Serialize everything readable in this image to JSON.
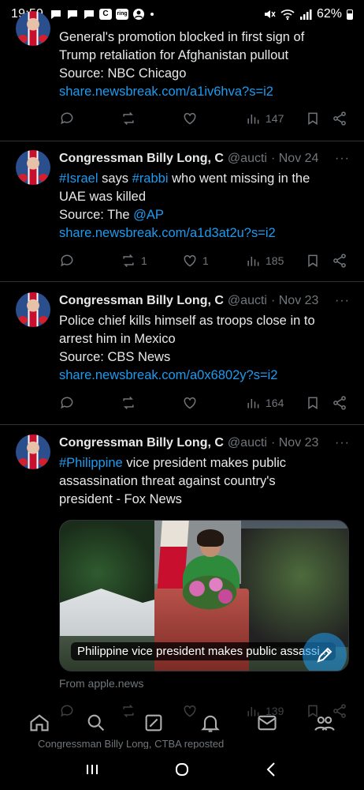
{
  "status_bar": {
    "time": "19:59",
    "notif_box_label": "C",
    "ring_label": "ring",
    "battery": "62%"
  },
  "tweets": [
    {
      "text_lines": [
        "General's promotion blocked in first sign of",
        "Trump retaliation for Afghanistan pullout",
        "Source: NBC Chicago"
      ],
      "link": "share.newsbreak.com/a1iv6hva?s=i2",
      "stats": {
        "replies": "",
        "reposts": "",
        "likes": "",
        "views": "147"
      }
    },
    {
      "author": "Congressman Billy Long, C",
      "handle": "@aucti",
      "date": "· Nov 24",
      "more": "···",
      "hashtag1": "#Israel",
      "word1": " says ",
      "hashtag2": "#rabbi",
      "rest1": " who went missing in the",
      "line2": "UAE was killed",
      "source_prefix": "Source: The ",
      "mention": "@AP",
      "link": "share.newsbreak.com/a1d3at2u?s=i2",
      "stats": {
        "replies": "",
        "reposts": "1",
        "likes": "1",
        "views": "185"
      }
    },
    {
      "author": "Congressman Billy Long, C",
      "handle": "@aucti",
      "date": "· Nov 23",
      "more": "···",
      "text_lines": [
        "Police chief kills himself as troops close in to",
        "arrest him in Mexico",
        "Source: CBS News"
      ],
      "link": "share.newsbreak.com/a0x6802y?s=i2",
      "stats": {
        "replies": "",
        "reposts": "",
        "likes": "",
        "views": "164"
      }
    },
    {
      "author": "Congressman Billy Long, C",
      "handle": "@aucti",
      "date": "· Nov 23",
      "more": "···",
      "hashtag1": "#Philippine",
      "rest1": " vice president makes public",
      "line2": "assassination threat against country's",
      "line3": "president - Fox News",
      "media_caption": "Philippine vice president makes public assassi...",
      "from": "From apple.news",
      "stats": {
        "replies": "",
        "reposts": "",
        "likes": "",
        "views": "139"
      }
    }
  ],
  "reposted_banner": "Congressman Billy Long, CTBA reposted",
  "bottom_nav": [
    "home-icon",
    "search-icon",
    "grok-icon",
    "notifications-icon",
    "messages-icon",
    "communities-icon"
  ],
  "colors": {
    "background": "#000000",
    "link": "#1d9bf0",
    "muted": "#71767b",
    "text": "#e7e9ea"
  }
}
